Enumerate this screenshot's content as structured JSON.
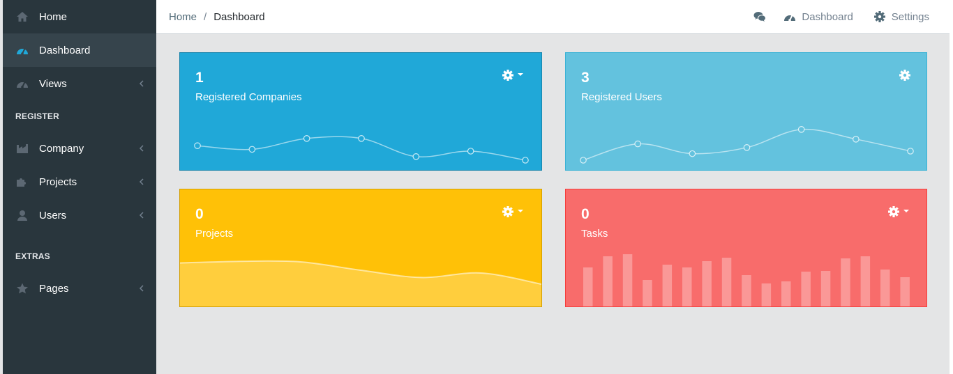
{
  "sidebar": {
    "home": "Home",
    "dashboard": "Dashboard",
    "views": "Views",
    "register_title": "REGISTER",
    "company": "Company",
    "projects": "Projects",
    "users": "Users",
    "extras_title": "EXTRAS",
    "pages": "Pages"
  },
  "breadcrumb": {
    "home": "Home",
    "separator": "/",
    "current": "Dashboard"
  },
  "topnav": {
    "dashboard": "Dashboard",
    "settings": "Settings"
  },
  "colors": {
    "sidebar_bg": "#29363d",
    "primary": "#20a8d8",
    "info": "#63c2de",
    "warning": "#ffc107",
    "danger": "#f86c6b"
  },
  "cards": [
    {
      "value": "1",
      "label": "Registered Companies",
      "chart_type": "line",
      "color": "#20a8d8",
      "data": [
        40,
        30,
        60,
        60,
        10,
        25,
        0
      ]
    },
    {
      "value": "3",
      "label": "Registered Users",
      "chart_type": "line",
      "color": "#63c2de",
      "data": [
        0,
        45,
        18,
        35,
        85,
        58,
        25
      ]
    },
    {
      "value": "0",
      "label": "Projects",
      "chart_type": "area",
      "color": "#ffc107",
      "data": [
        78,
        81,
        80,
        65,
        52,
        60,
        40
      ]
    },
    {
      "value": "0",
      "label": "Tasks",
      "chart_type": "bar",
      "color": "#f86c6b",
      "data": [
        56,
        72,
        75,
        38,
        60,
        56,
        65,
        70,
        45,
        33,
        36,
        50,
        51,
        69,
        72,
        53,
        42
      ]
    }
  ]
}
